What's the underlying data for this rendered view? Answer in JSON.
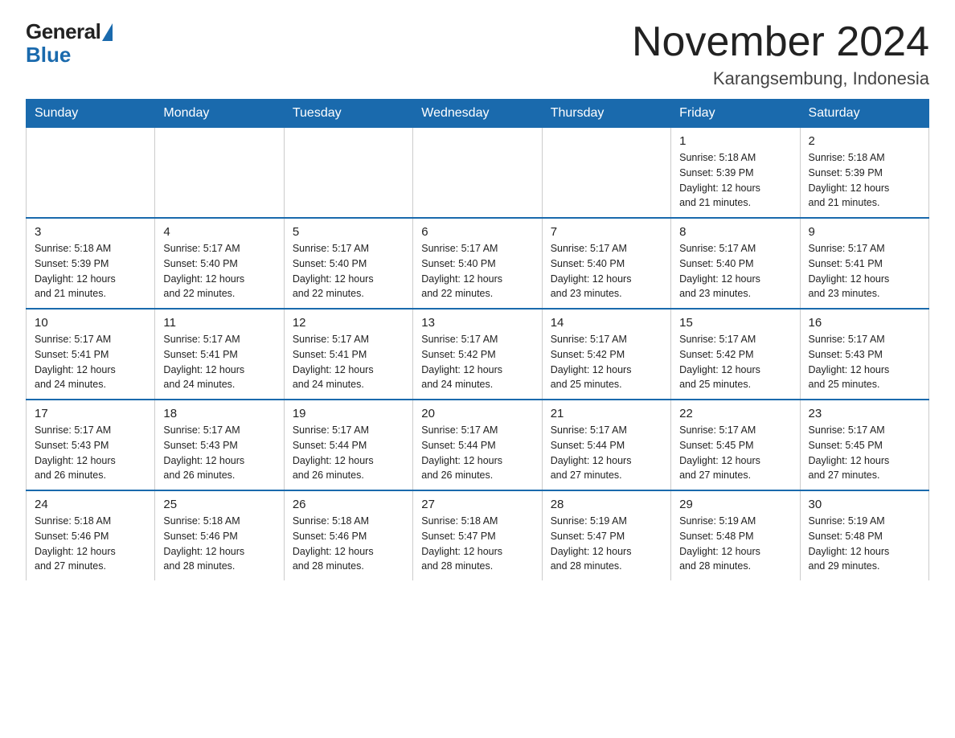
{
  "logo": {
    "general": "General",
    "blue": "Blue"
  },
  "title": {
    "month_year": "November 2024",
    "location": "Karangsembung, Indonesia"
  },
  "weekdays": [
    "Sunday",
    "Monday",
    "Tuesday",
    "Wednesday",
    "Thursday",
    "Friday",
    "Saturday"
  ],
  "weeks": [
    [
      {
        "day": "",
        "info": ""
      },
      {
        "day": "",
        "info": ""
      },
      {
        "day": "",
        "info": ""
      },
      {
        "day": "",
        "info": ""
      },
      {
        "day": "",
        "info": ""
      },
      {
        "day": "1",
        "info": "Sunrise: 5:18 AM\nSunset: 5:39 PM\nDaylight: 12 hours\nand 21 minutes."
      },
      {
        "day": "2",
        "info": "Sunrise: 5:18 AM\nSunset: 5:39 PM\nDaylight: 12 hours\nand 21 minutes."
      }
    ],
    [
      {
        "day": "3",
        "info": "Sunrise: 5:18 AM\nSunset: 5:39 PM\nDaylight: 12 hours\nand 21 minutes."
      },
      {
        "day": "4",
        "info": "Sunrise: 5:17 AM\nSunset: 5:40 PM\nDaylight: 12 hours\nand 22 minutes."
      },
      {
        "day": "5",
        "info": "Sunrise: 5:17 AM\nSunset: 5:40 PM\nDaylight: 12 hours\nand 22 minutes."
      },
      {
        "day": "6",
        "info": "Sunrise: 5:17 AM\nSunset: 5:40 PM\nDaylight: 12 hours\nand 22 minutes."
      },
      {
        "day": "7",
        "info": "Sunrise: 5:17 AM\nSunset: 5:40 PM\nDaylight: 12 hours\nand 23 minutes."
      },
      {
        "day": "8",
        "info": "Sunrise: 5:17 AM\nSunset: 5:40 PM\nDaylight: 12 hours\nand 23 minutes."
      },
      {
        "day": "9",
        "info": "Sunrise: 5:17 AM\nSunset: 5:41 PM\nDaylight: 12 hours\nand 23 minutes."
      }
    ],
    [
      {
        "day": "10",
        "info": "Sunrise: 5:17 AM\nSunset: 5:41 PM\nDaylight: 12 hours\nand 24 minutes."
      },
      {
        "day": "11",
        "info": "Sunrise: 5:17 AM\nSunset: 5:41 PM\nDaylight: 12 hours\nand 24 minutes."
      },
      {
        "day": "12",
        "info": "Sunrise: 5:17 AM\nSunset: 5:41 PM\nDaylight: 12 hours\nand 24 minutes."
      },
      {
        "day": "13",
        "info": "Sunrise: 5:17 AM\nSunset: 5:42 PM\nDaylight: 12 hours\nand 24 minutes."
      },
      {
        "day": "14",
        "info": "Sunrise: 5:17 AM\nSunset: 5:42 PM\nDaylight: 12 hours\nand 25 minutes."
      },
      {
        "day": "15",
        "info": "Sunrise: 5:17 AM\nSunset: 5:42 PM\nDaylight: 12 hours\nand 25 minutes."
      },
      {
        "day": "16",
        "info": "Sunrise: 5:17 AM\nSunset: 5:43 PM\nDaylight: 12 hours\nand 25 minutes."
      }
    ],
    [
      {
        "day": "17",
        "info": "Sunrise: 5:17 AM\nSunset: 5:43 PM\nDaylight: 12 hours\nand 26 minutes."
      },
      {
        "day": "18",
        "info": "Sunrise: 5:17 AM\nSunset: 5:43 PM\nDaylight: 12 hours\nand 26 minutes."
      },
      {
        "day": "19",
        "info": "Sunrise: 5:17 AM\nSunset: 5:44 PM\nDaylight: 12 hours\nand 26 minutes."
      },
      {
        "day": "20",
        "info": "Sunrise: 5:17 AM\nSunset: 5:44 PM\nDaylight: 12 hours\nand 26 minutes."
      },
      {
        "day": "21",
        "info": "Sunrise: 5:17 AM\nSunset: 5:44 PM\nDaylight: 12 hours\nand 27 minutes."
      },
      {
        "day": "22",
        "info": "Sunrise: 5:17 AM\nSunset: 5:45 PM\nDaylight: 12 hours\nand 27 minutes."
      },
      {
        "day": "23",
        "info": "Sunrise: 5:17 AM\nSunset: 5:45 PM\nDaylight: 12 hours\nand 27 minutes."
      }
    ],
    [
      {
        "day": "24",
        "info": "Sunrise: 5:18 AM\nSunset: 5:46 PM\nDaylight: 12 hours\nand 27 minutes."
      },
      {
        "day": "25",
        "info": "Sunrise: 5:18 AM\nSunset: 5:46 PM\nDaylight: 12 hours\nand 28 minutes."
      },
      {
        "day": "26",
        "info": "Sunrise: 5:18 AM\nSunset: 5:46 PM\nDaylight: 12 hours\nand 28 minutes."
      },
      {
        "day": "27",
        "info": "Sunrise: 5:18 AM\nSunset: 5:47 PM\nDaylight: 12 hours\nand 28 minutes."
      },
      {
        "day": "28",
        "info": "Sunrise: 5:19 AM\nSunset: 5:47 PM\nDaylight: 12 hours\nand 28 minutes."
      },
      {
        "day": "29",
        "info": "Sunrise: 5:19 AM\nSunset: 5:48 PM\nDaylight: 12 hours\nand 28 minutes."
      },
      {
        "day": "30",
        "info": "Sunrise: 5:19 AM\nSunset: 5:48 PM\nDaylight: 12 hours\nand 29 minutes."
      }
    ]
  ]
}
